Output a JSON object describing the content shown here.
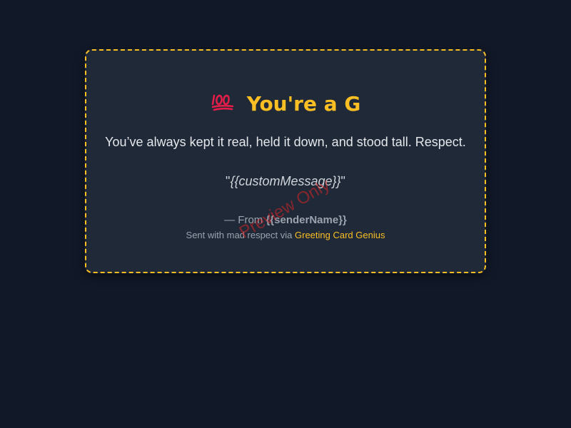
{
  "card": {
    "icon": "hundred-points-icon",
    "title": "You're a G",
    "subtitle": "You’ve always kept it real, held it down, and stood tall. Respect.",
    "quote_open": "\"",
    "custom_message": "{{customMessage}}",
    "quote_close": "\"",
    "from_prefix": "— From ",
    "sender_name": "{{senderName}}",
    "sent_prefix": "Sent with mad respect via ",
    "sent_link": "Greeting Card Genius",
    "watermark": "Preview Only"
  },
  "colors": {
    "background": "#111827",
    "card": "#1f2937",
    "accent": "#fbbf24",
    "icon": "#e11d48",
    "watermark": "#dc2626"
  }
}
